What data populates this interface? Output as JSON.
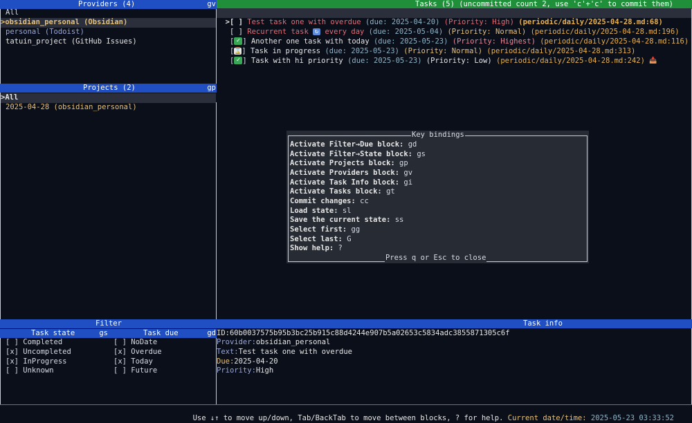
{
  "providers": {
    "title": "Providers (4)",
    "shortcut": "gv",
    "items": [
      {
        "label": "All",
        "selected": false
      },
      {
        "label": ">obsidian_personal (Obsidian)",
        "selected": true
      },
      {
        "label": "personal (Todoist)",
        "selected": false
      },
      {
        "label": "tatuin_project (GitHub Issues)",
        "selected": false
      }
    ]
  },
  "projects": {
    "title": "Projects (2)",
    "shortcut": "gp",
    "items": [
      {
        "label": ">All",
        "selected": true
      },
      {
        "label": "2025-04-28 (obsidian_personal)",
        "selected": false
      }
    ]
  },
  "tasks": {
    "title": "Tasks (5) (uncommitted count 2, use 'c'+'c' to commit them)",
    "items": [
      {
        "prefix": ">[ ] ",
        "text": "Test task one with overdue",
        "due": "(due: 2025-04-20)",
        "priority": "(Priority: High)",
        "path": "(periodic/daily/2025-04-28.md:68)"
      },
      {
        "prefix": " [ ] ",
        "text": "Recurrent task",
        "recur": "every day",
        "due": "(due: 2025-05-04)",
        "priority": "(Priority: Normal)",
        "path": "(periodic/daily/2025-04-28.md:196)"
      },
      {
        "prefix": " [",
        "check": "✓",
        "suffix": "] ",
        "text": "Another one task with today",
        "due": "(due: 2025-05-23)",
        "priority": "(Priority: Highest)",
        "path": "(periodic/daily/2025-04-28.md:116)"
      },
      {
        "prefix": " [",
        "check": "⌛",
        "suffix": "] ",
        "text": "Task in progress",
        "due": "(due: 2025-05-23)",
        "priority": "(Priority: Normal)",
        "path": "(periodic/daily/2025-04-28.md:313)"
      },
      {
        "prefix": " [",
        "check": "✓",
        "suffix": "] ",
        "text": "Task with hi priority",
        "due": "(due: 2025-05-23)",
        "priority": "(Priority: Low)",
        "path": "(periodic/daily/2025-04-28.md:242)"
      }
    ]
  },
  "keybindings": {
    "title": "Key bindings",
    "footer": "Press q or Esc to close",
    "items": [
      {
        "label": "Activate Filter→Due block:",
        "key": "gd"
      },
      {
        "label": "Activate Filter→State block:",
        "key": "gs"
      },
      {
        "label": "Activate Projects block:",
        "key": "gp"
      },
      {
        "label": "Activate Providers block:",
        "key": "gv"
      },
      {
        "label": "Activate Task Info block:",
        "key": "gi"
      },
      {
        "label": "Activate Tasks block:",
        "key": "gt"
      },
      {
        "label": "Commit changes:",
        "key": "cc"
      },
      {
        "label": "Load state:",
        "key": "sl"
      },
      {
        "label": "Save the current state:",
        "key": "ss"
      },
      {
        "label": "Select first:",
        "key": "gg"
      },
      {
        "label": "Select last:",
        "key": "G"
      },
      {
        "label": "Show help:",
        "key": "?"
      }
    ]
  },
  "filter": {
    "title": "Filter",
    "state": {
      "title": "Task state",
      "shortcut": "gs",
      "items": [
        {
          "label": "[ ] Completed"
        },
        {
          "label": "[x] Uncompleted"
        },
        {
          "label": "[x] InProgress"
        },
        {
          "label": "[ ] Unknown"
        }
      ]
    },
    "due": {
      "title": "Task due",
      "shortcut": "gd",
      "items": [
        {
          "label": "[ ] NoDate"
        },
        {
          "label": "[x] Overdue"
        },
        {
          "label": "[x] Today"
        },
        {
          "label": "[ ] Future"
        }
      ]
    }
  },
  "task_info": {
    "title": "Task info",
    "id": "ID:60b0037575b95b3bc25b915c88d4244e907b5a02653c5834adc3855871305c6f",
    "provider_key": "Provider:",
    "provider": "obsidian_personal",
    "text_key": "Text:",
    "text": "Test task one with overdue",
    "due_key": "Due:",
    "due": "2025-04-20",
    "priority_key": "Priority:",
    "priority": "High"
  },
  "status": {
    "help": "Use ↓↑ to move up/down, Tab/BackTab to move between blocks, ? for help.",
    "date_label": "Current date/time:",
    "date_value": "2025-05-23 03:33:52"
  },
  "colors": {
    "blue_bar": "#1f4fc2",
    "green_bar": "#1f8f3a",
    "overdue_red": "#e06c75",
    "path_gold": "#e8b04c"
  },
  "icons": {
    "done_check": "green-check-icon",
    "in_progress": "hourglass-icon",
    "recurrent": "repeat-icon",
    "inbox": "inbox-tray-icon"
  }
}
